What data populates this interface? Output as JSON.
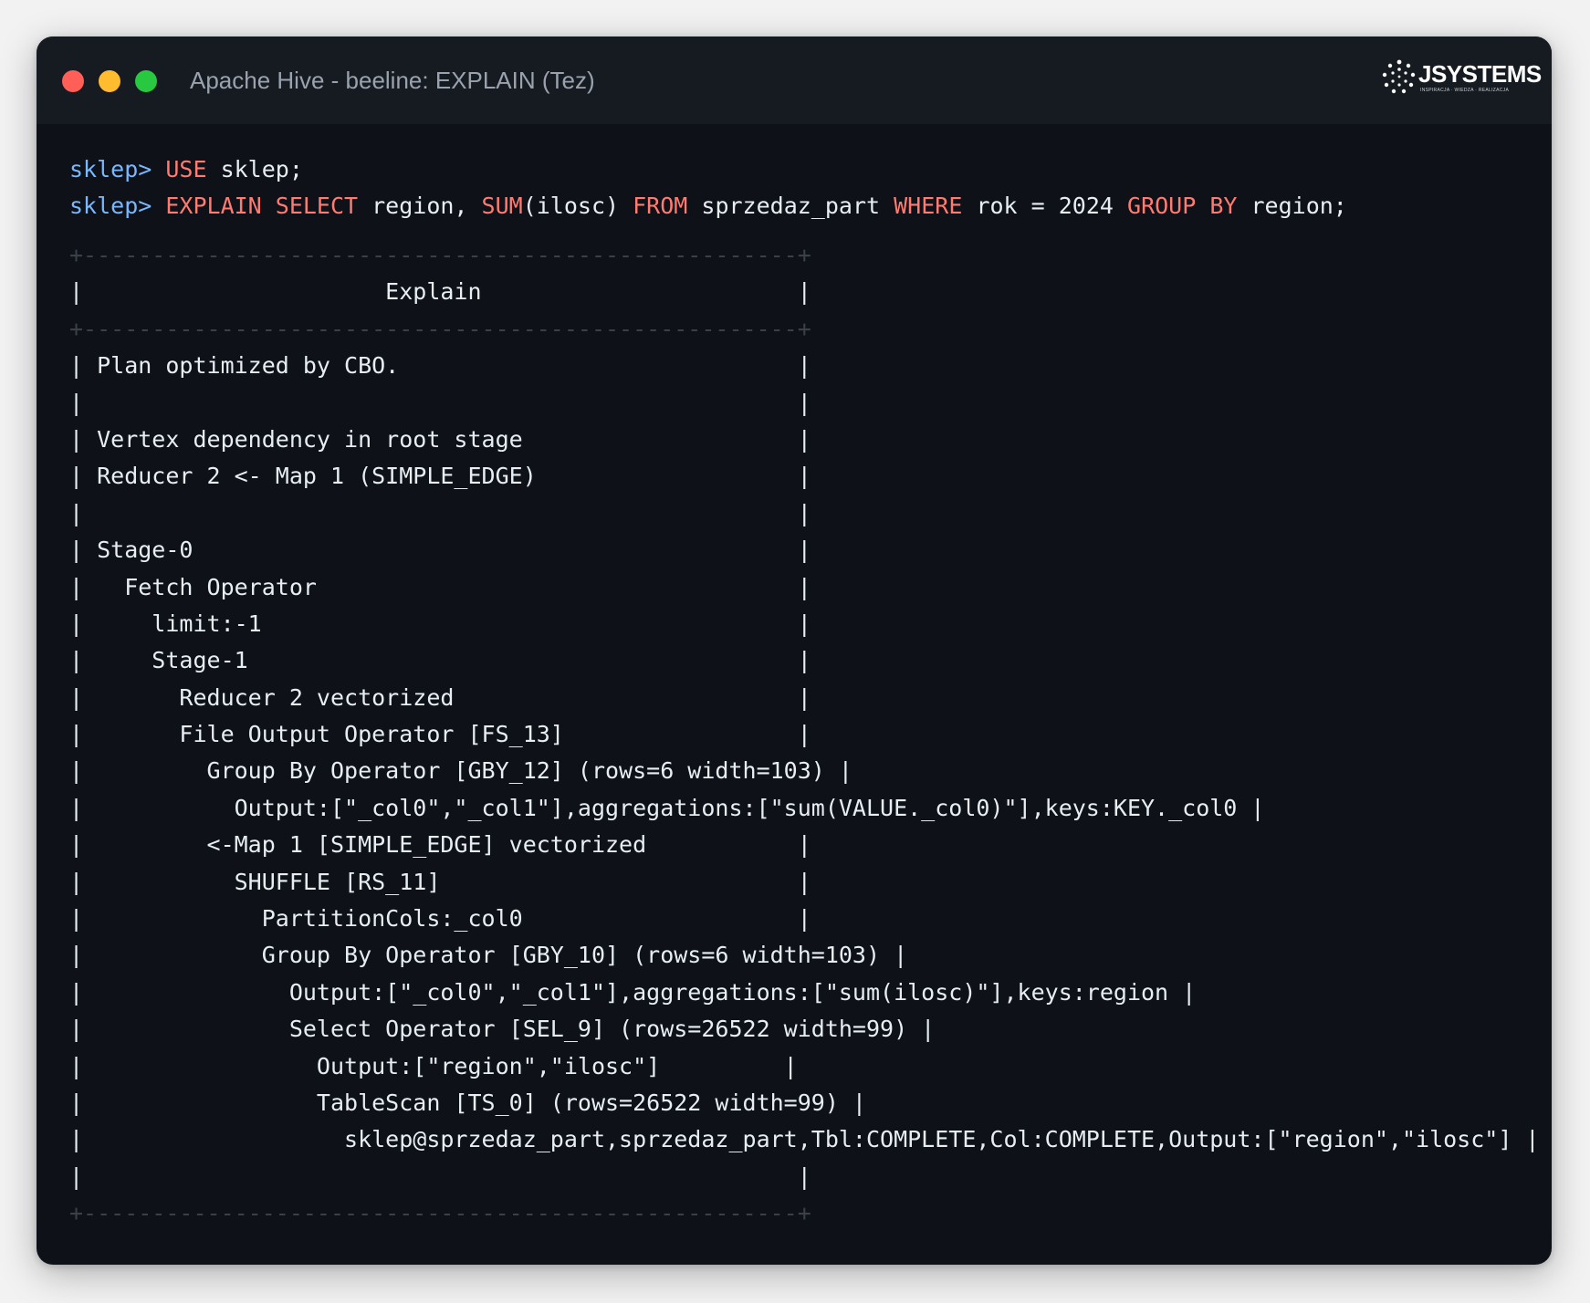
{
  "window": {
    "title": "Apache Hive - beeline: EXPLAIN (Tez)",
    "controls": {
      "close": "#ff5f57",
      "minimize": "#febc2e",
      "maximize": "#28c840"
    },
    "logo": {
      "text": "JSYSTEMS",
      "tagline": "INSPIRACJA · WIEDZA · REALIZACJA"
    }
  },
  "colors": {
    "background": "#0e1117",
    "prompt": "#79b8ff",
    "keyword": "#ff7b72",
    "text": "#e6edf3"
  },
  "commands": [
    {
      "prompt": "sklep> ",
      "segments": [
        {
          "t": "USE",
          "kw": true
        },
        {
          "t": " sklep;",
          "kw": false
        }
      ]
    },
    {
      "prompt": "sklep> ",
      "segments": [
        {
          "t": "EXPLAIN SELECT",
          "kw": true
        },
        {
          "t": " region, ",
          "kw": false
        },
        {
          "t": "SUM",
          "kw": true
        },
        {
          "t": "(ilosc) ",
          "kw": false
        },
        {
          "t": "FROM",
          "kw": true
        },
        {
          "t": " sprzedaz_part ",
          "kw": false
        },
        {
          "t": "WHERE",
          "kw": true
        },
        {
          "t": " rok = 2024 ",
          "kw": false
        },
        {
          "t": "GROUP BY",
          "kw": true
        },
        {
          "t": " region;",
          "kw": false
        }
      ]
    }
  ],
  "output": {
    "border_top": "+----------------------------------------------------+",
    "header": "|                      Explain                       |",
    "border_mid": "+----------------------------------------------------+",
    "rows": [
      "| Plan optimized by CBO.                             |",
      "|                                                    |",
      "| Vertex dependency in root stage                    |",
      "| Reducer 2 <- Map 1 (SIMPLE_EDGE)                   |",
      "|                                                    |",
      "| Stage-0                                            |",
      "|   Fetch Operator                                   |",
      "|     limit:-1                                       |",
      "|     Stage-1                                        |",
      "|       Reducer 2 vectorized                         |",
      "|       File Output Operator [FS_13]                 |",
      "|         Group By Operator [GBY_12] (rows=6 width=103) |",
      "|           Output:[\"_col0\",\"_col1\"],aggregations:[\"sum(VALUE._col0)\"],keys:KEY._col0 |",
      "|         <-Map 1 [SIMPLE_EDGE] vectorized           |",
      "|           SHUFFLE [RS_11]                          |",
      "|             PartitionCols:_col0                    |",
      "|             Group By Operator [GBY_10] (rows=6 width=103) |",
      "|               Output:[\"_col0\",\"_col1\"],aggregations:[\"sum(ilosc)\"],keys:region |",
      "|               Select Operator [SEL_9] (rows=26522 width=99) |",
      "|                 Output:[\"region\",\"ilosc\"]         |",
      "|                 TableScan [TS_0] (rows=26522 width=99) |",
      "|                   sklep@sprzedaz_part,sprzedaz_part,Tbl:COMPLETE,Col:COMPLETE,Output:[\"region\",\"ilosc\"] |",
      "|                                                    |"
    ],
    "border_bottom": "+----------------------------------------------------+"
  }
}
